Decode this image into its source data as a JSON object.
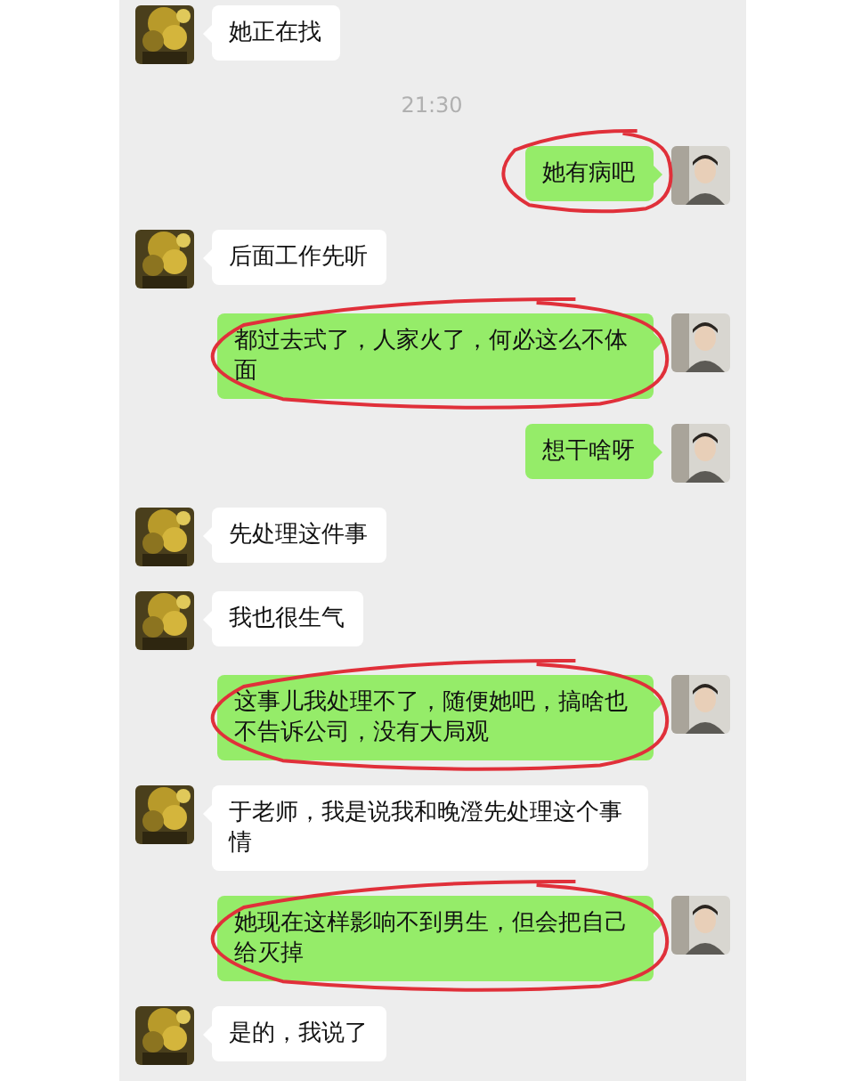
{
  "messages": [
    {
      "kind": "left",
      "text": "她正在找",
      "circled": false
    },
    {
      "kind": "time",
      "text": "21:30"
    },
    {
      "kind": "right",
      "text": "她有病吧",
      "circled": true
    },
    {
      "kind": "left",
      "text": "后面工作先听",
      "circled": false
    },
    {
      "kind": "right",
      "text": "都过去式了，人家火了，何必这么不体面",
      "circled": true
    },
    {
      "kind": "right",
      "text": "想干啥呀",
      "circled": false
    },
    {
      "kind": "left",
      "text": "先处理这件事",
      "circled": false
    },
    {
      "kind": "left",
      "text": "我也很生气",
      "circled": false
    },
    {
      "kind": "right",
      "text": "这事儿我处理不了，随便她吧，搞啥也不告诉公司，没有大局观",
      "circled": true
    },
    {
      "kind": "left",
      "text": "于老师，我是说我和晚澄先处理这个事情",
      "circled": false
    },
    {
      "kind": "right",
      "text": "她现在这样影响不到男生，但会把自己给灭掉",
      "circled": true
    },
    {
      "kind": "left",
      "text": "是的，我说了",
      "circled": false
    }
  ]
}
